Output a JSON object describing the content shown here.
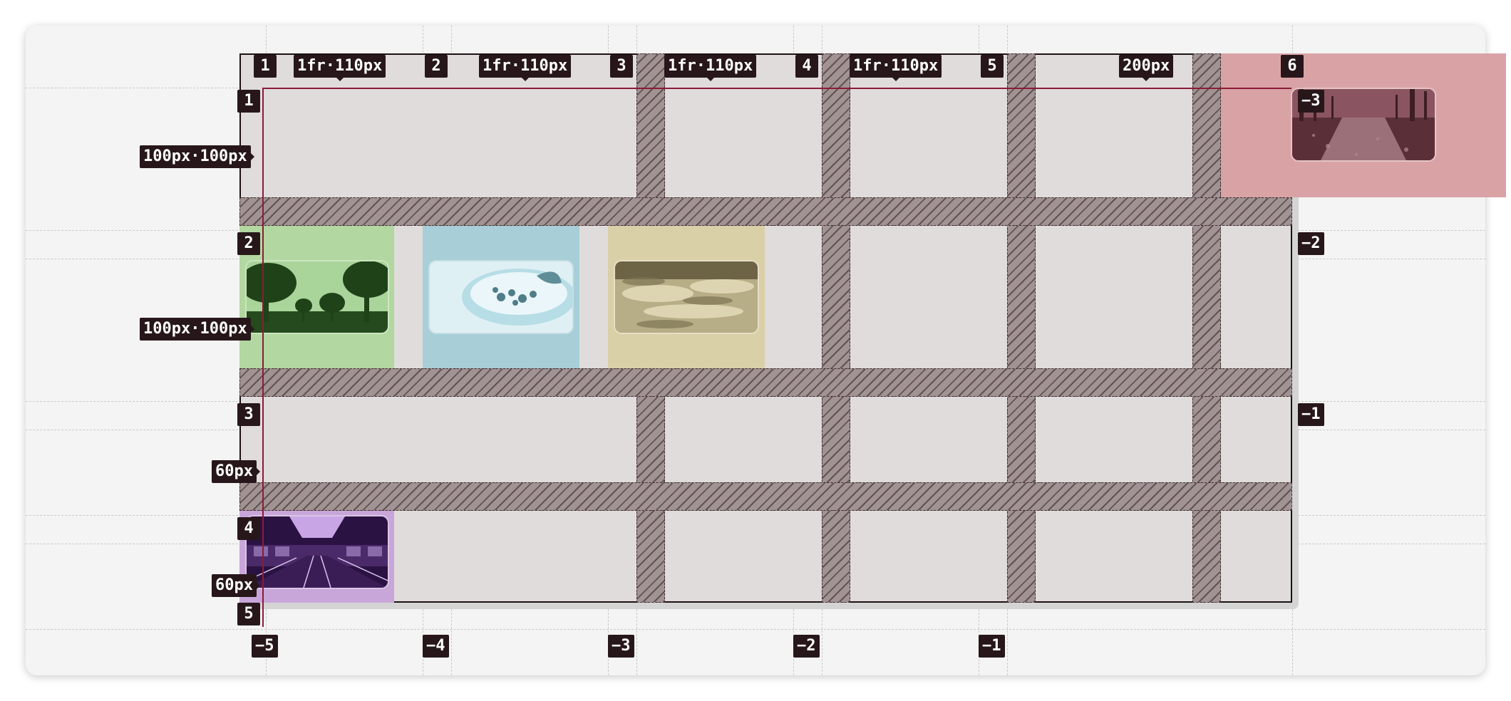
{
  "grid": {
    "column_tracks": [
      "1fr·110px",
      "1fr·110px",
      "1fr·110px",
      "1fr·110px",
      "200px"
    ],
    "row_tracks": [
      "100px·100px",
      "100px·100px",
      "60px",
      "60px"
    ],
    "col_line_numbers": [
      "1",
      "2",
      "3",
      "4",
      "5",
      "6"
    ],
    "col_negative_numbers": [
      "−5",
      "−4",
      "−3",
      "−2",
      "−1"
    ],
    "row_line_numbers": [
      "1",
      "2",
      "3",
      "4",
      "5"
    ],
    "row_negative_numbers": [
      "−3",
      "−2",
      "−1"
    ]
  },
  "items": [
    {
      "name": "forest-path-image",
      "color": "#d9a3a6"
    },
    {
      "name": "trees-image",
      "color": "#b2d7a0"
    },
    {
      "name": "bowl-image",
      "color": "#a8ced7"
    },
    {
      "name": "clouds-image",
      "color": "#d9d0a8"
    },
    {
      "name": "station-image",
      "color": "#c8a6d9"
    }
  ],
  "colors": {
    "grid_background": "#e0dcdc",
    "gap": "#a19393",
    "label_background": "#27171a",
    "accent_line": "#8c1b38"
  }
}
